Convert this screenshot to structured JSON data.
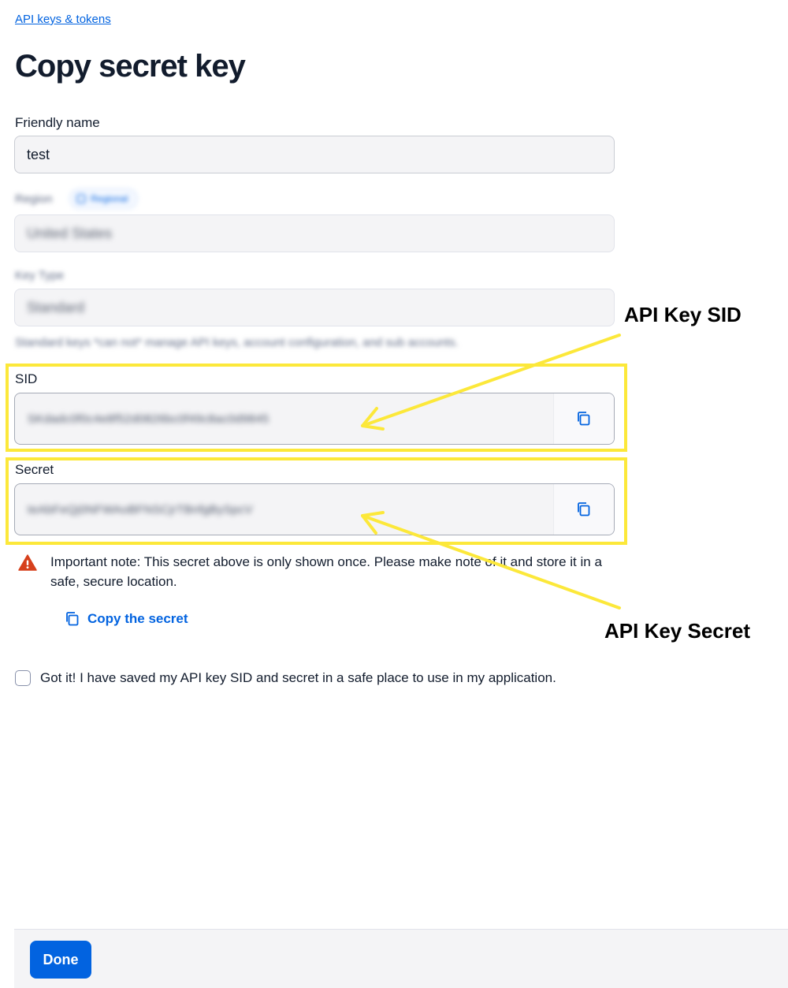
{
  "breadcrumb": "API keys & tokens",
  "page_title": "Copy secret key",
  "friendly_name": {
    "label": "Friendly name",
    "value": "test"
  },
  "region": {
    "label": "Region",
    "badge": "Regional",
    "value": "United States"
  },
  "key_type": {
    "label": "Key Type",
    "value": "Standard",
    "help": "Standard keys *can not* manage API keys, account configuration, and sub accounts."
  },
  "sid": {
    "label": "SID",
    "value": "SKdadc0f0c4e8f52d0826bc0f49c8ac0d9845"
  },
  "secret": {
    "label": "Secret",
    "value": "teAbFeQj0NFWAoBFNSCjrTBnfgBySpcV"
  },
  "note": "Important note: This secret above is only shown once. Please make note of it and store it in a safe, secure location.",
  "copy_secret": "Copy the secret",
  "confirm_checkbox": "Got it! I have saved my API key SID and secret in a safe place to use in my application.",
  "done_button": "Done",
  "annotations": {
    "sid": "API Key SID",
    "secret": "API Key Secret"
  },
  "colors": {
    "primary": "#0263e0",
    "highlight": "#fce83a",
    "warning": "#d6401c"
  },
  "icons": {
    "copy": "copy-icon",
    "warning": "warning-icon",
    "region_badge": "region-icon"
  }
}
